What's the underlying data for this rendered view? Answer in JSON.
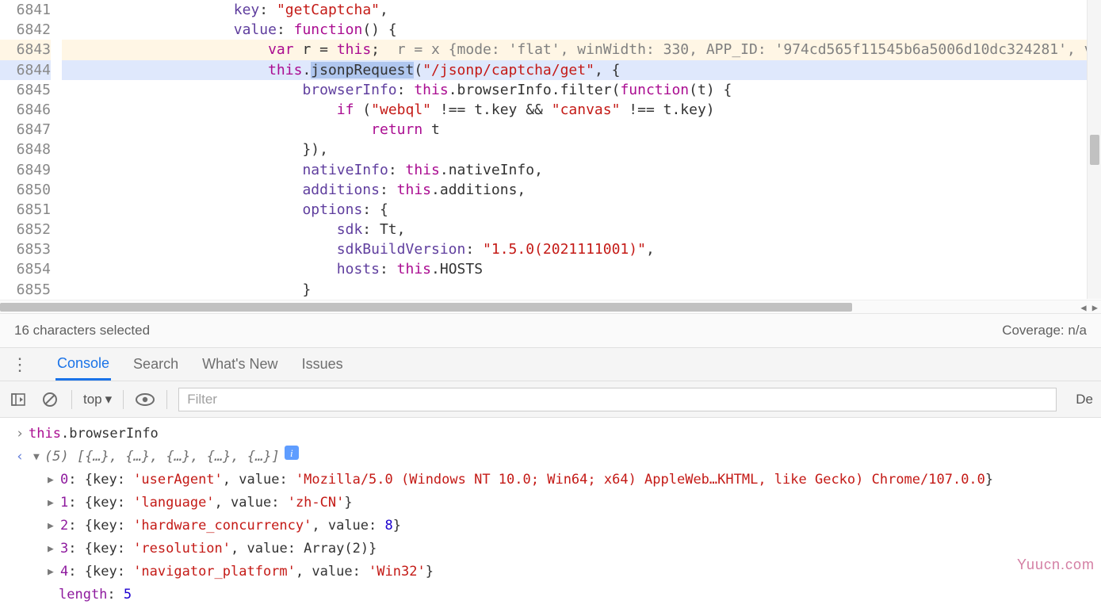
{
  "gutter": [
    "6841",
    "6842",
    "6843",
    "6844",
    "6845",
    "6846",
    "6847",
    "6848",
    "6849",
    "6850",
    "6851",
    "6852",
    "6853",
    "6854",
    "6855"
  ],
  "code": {
    "l6841": {
      "indent": "                    ",
      "prop": "key",
      "colon": ": ",
      "str": "\"getCaptcha\"",
      "tail": ","
    },
    "l6842": {
      "indent": "                    ",
      "prop": "value",
      "colon": ": ",
      "kw": "function",
      "tail": "() {"
    },
    "l6843": {
      "indent": "                        ",
      "kw": "var",
      "sp": " ",
      "id": "r",
      "eq": " = ",
      "th": "this",
      "end": ";",
      "overlay": "  r = x {mode: 'flat', winWidth: 330, APP_ID: '974cd565f11545b6a5006d10dc324281', v"
    },
    "l6844": {
      "indent": "                        ",
      "th": "this",
      "dot": ".",
      "fn": "jsonpRequest",
      "args_pre": "(",
      "url": "\"/jsonp/captcha/get\"",
      "args_post": ", {"
    },
    "l6845": {
      "indent": "                            ",
      "prop": "browserInfo",
      "colon": ": ",
      "th": "this",
      "rest": ".browserInfo.filter(",
      "kw": "function",
      "tail": "(t) {"
    },
    "l6846": {
      "indent": "                                ",
      "kw": "if",
      "pre": " (",
      "s1": "\"webql\"",
      "mid": " !== t.key && ",
      "s2": "\"canvas\"",
      "post": " !== t.key)"
    },
    "l6847": {
      "indent": "                                    ",
      "kw": "return",
      "rest": " t"
    },
    "l6848": {
      "indent": "                            ",
      "rest": "}),"
    },
    "l6849": {
      "indent": "                            ",
      "prop": "nativeInfo",
      "colon": ": ",
      "th": "this",
      "rest": ".nativeInfo,"
    },
    "l6850": {
      "indent": "                            ",
      "prop": "additions",
      "colon": ": ",
      "th": "this",
      "rest": ".additions,"
    },
    "l6851": {
      "indent": "                            ",
      "prop": "options",
      "rest": ": {"
    },
    "l6852": {
      "indent": "                                ",
      "prop": "sdk",
      "rest": ": Tt,"
    },
    "l6853": {
      "indent": "                                ",
      "prop": "sdkBuildVersion",
      "colon": ": ",
      "str": "\"1.5.0(2021111001)\"",
      "rest": ","
    },
    "l6854": {
      "indent": "                                ",
      "prop": "hosts",
      "colon": ": ",
      "th": "this",
      "rest": ".HOSTS"
    },
    "l6855": {
      "indent": "                            ",
      "rest": "}"
    }
  },
  "status": {
    "selection": "16 characters selected",
    "coverage": "Coverage: n/a"
  },
  "tabs": {
    "console": "Console",
    "search": "Search",
    "whatsnew": "What's New",
    "issues": "Issues"
  },
  "toolbar": {
    "context": "top",
    "filter_placeholder": "Filter",
    "right": "De"
  },
  "console": {
    "expr": {
      "this": "this",
      "dot": ".",
      "prop": "browserInfo"
    },
    "result": {
      "head_count": "(5)",
      "head_arr": " [{…}, {…}, {…}, {…}, {…}]",
      "entries": [
        {
          "idx": "0",
          "key": "'userAgent'",
          "val": "'Mozilla/5.0 (Windows NT 10.0; Win64; x64) AppleWeb…KHTML, like Gecko) Chrome/107.0.0",
          "type": "str"
        },
        {
          "idx": "1",
          "key": "'language'",
          "val": "'zh-CN'",
          "type": "str"
        },
        {
          "idx": "2",
          "key": "'hardware_concurrency'",
          "val": "8",
          "type": "num"
        },
        {
          "idx": "3",
          "key": "'resolution'",
          "val": "Array(2)",
          "type": "plain"
        },
        {
          "idx": "4",
          "key": "'navigator_platform'",
          "val": "'Win32'",
          "type": "str"
        }
      ],
      "length_label": "length",
      "length_val": "5"
    }
  },
  "watermark": "Yuucn.com"
}
